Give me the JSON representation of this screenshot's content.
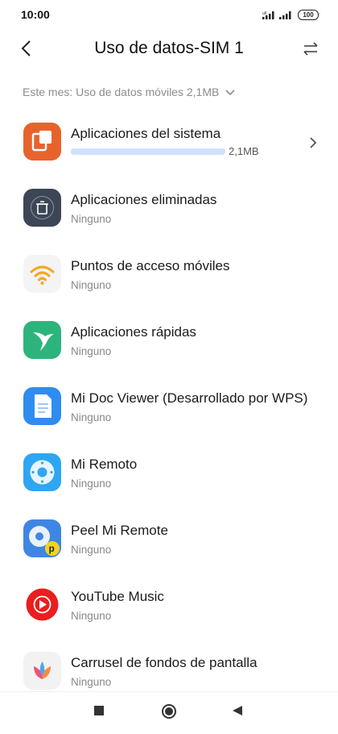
{
  "status": {
    "time": "10:00",
    "battery": "100"
  },
  "header": {
    "title": "Uso de datos-SIM 1",
    "back_icon": "back-arrow-icon",
    "switch_icon": "swap-arrows-icon"
  },
  "period_selector": {
    "label": "Este mes: Uso de datos móviles 2,1MB"
  },
  "apps": [
    {
      "name": "Aplicaciones del sistema",
      "usage": "2,1MB",
      "usage_fraction": 1.0,
      "icon": "system-apps-icon",
      "color": "#e8632b"
    },
    {
      "name": "Aplicaciones eliminadas",
      "sub": "Ninguno",
      "icon": "trash-icon",
      "color": "#3c4656"
    },
    {
      "name": "Puntos de acceso móviles",
      "sub": "Ninguno",
      "icon": "wifi-hotspot-icon",
      "color": "#f4f4f4"
    },
    {
      "name": "Aplicaciones rápidas",
      "sub": "Ninguno",
      "icon": "hummingbird-icon",
      "color": "#2db47d"
    },
    {
      "name": "Mi Doc Viewer (Desarrollado por WPS)",
      "sub": "Ninguno",
      "icon": "document-icon",
      "color": "#2f8cf0"
    },
    {
      "name": "Mi Remoto",
      "sub": "Ninguno",
      "icon": "remote-icon",
      "color": "#2fa6f2"
    },
    {
      "name": "Peel Mi Remote",
      "sub": "Ninguno",
      "icon": "peel-remote-icon",
      "color": "#3f86e4"
    },
    {
      "name": "YouTube Music",
      "sub": "Ninguno",
      "icon": "youtube-music-icon",
      "color": "#e91e1e"
    },
    {
      "name": "Carrusel de fondos de pantalla",
      "sub": "Ninguno",
      "icon": "wallpaper-carousel-icon",
      "color": "#f2f2f2"
    }
  ],
  "navbar": {
    "recents_icon": "square-icon",
    "home_icon": "circle-icon",
    "back_icon": "triangle-back-icon"
  }
}
